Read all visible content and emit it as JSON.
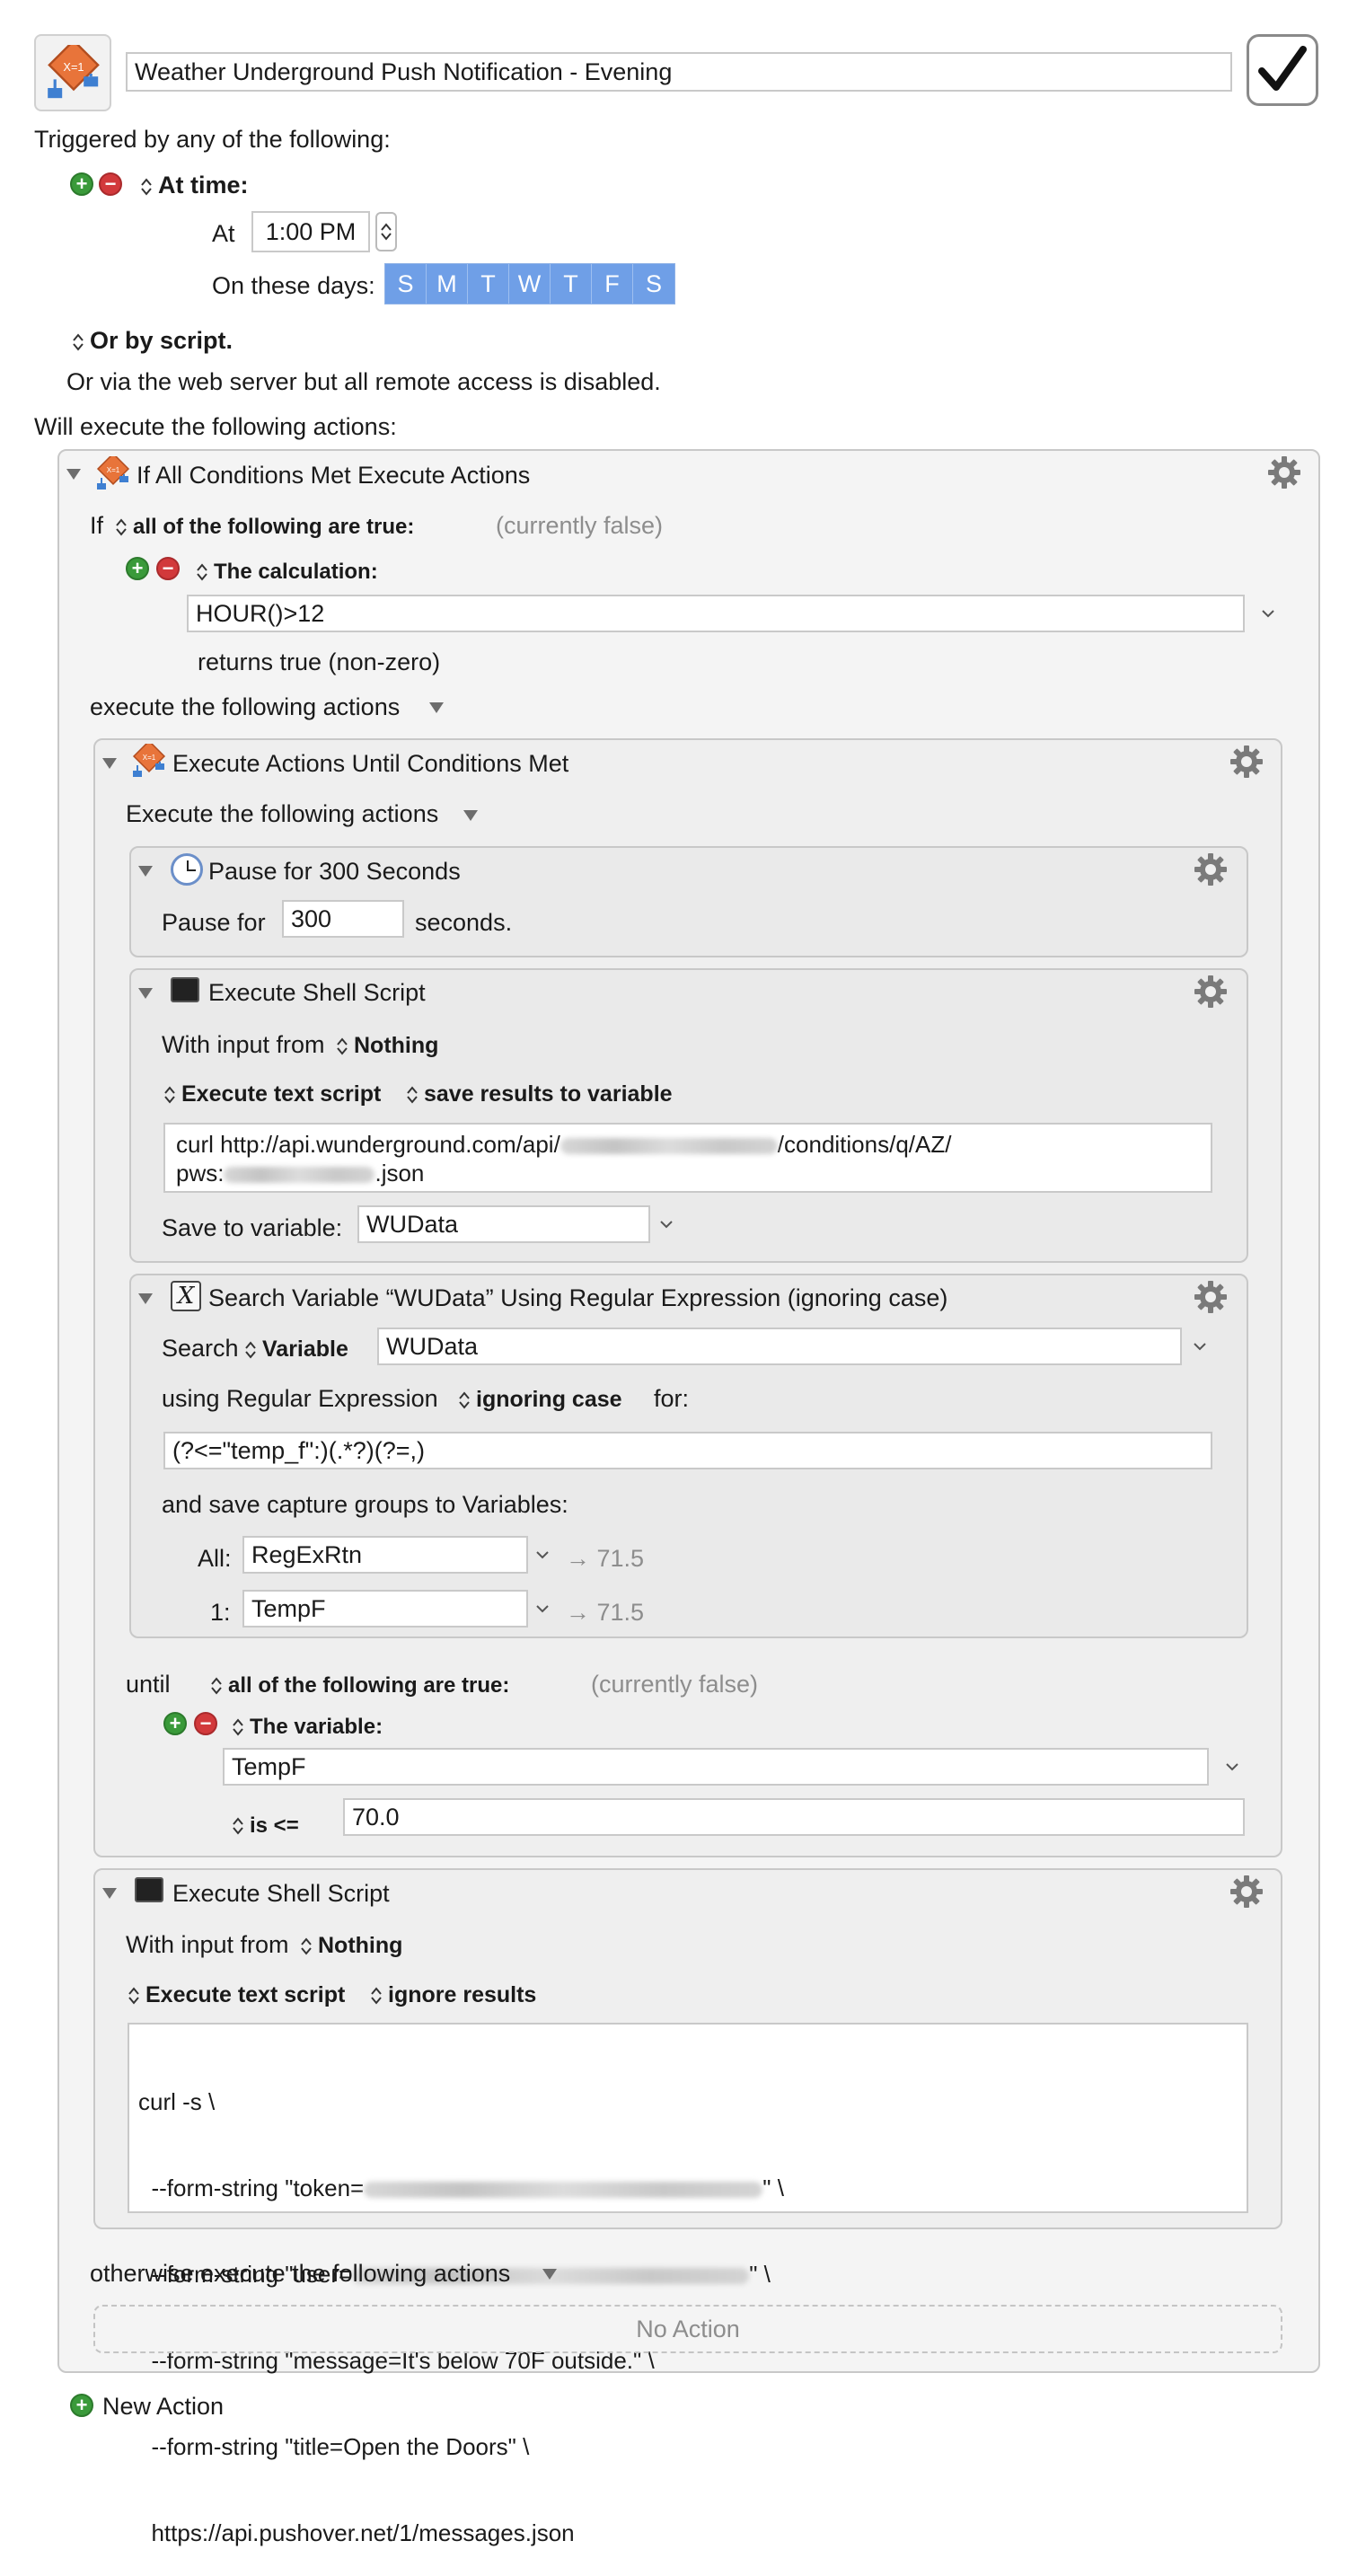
{
  "macro": {
    "name": "Weather Underground Push Notification - Evening",
    "enabled": true
  },
  "triggers": {
    "header": "Triggered by any of the following:",
    "at_time": {
      "title": "At time:",
      "at_label": "At",
      "time_value": "1:00 PM",
      "days_label": "On these days:",
      "days": [
        "S",
        "M",
        "T",
        "W",
        "T",
        "F",
        "S"
      ]
    },
    "or_by_script": "Or by script.",
    "web_server_note": "Or via the web server but all remote access is disabled."
  },
  "actions_header": "Will execute the following actions:",
  "if_action": {
    "title": "If All Conditions Met Execute Actions",
    "if_label": "If",
    "condition_mode": "all of the following are true:",
    "condition_state": "(currently false)",
    "calc_title": "The calculation:",
    "calc_value": "HOUR()>12",
    "calc_note": "returns true (non-zero)",
    "then_label": "execute the following actions",
    "otherwise_label": "otherwise execute the following actions",
    "no_action": "No Action"
  },
  "until_action": {
    "title": "Execute Actions Until Conditions Met",
    "exec_label": "Execute the following actions",
    "pause": {
      "title": "Pause for 300 Seconds",
      "label": "Pause for",
      "value": "300",
      "unit": "seconds."
    },
    "shell1": {
      "title": "Execute Shell Script",
      "input_label": "With input from",
      "input_value": "Nothing",
      "mode": "Execute text script",
      "result_mode": "save results to variable",
      "script_line1_a": "curl http://api.wunderground.com/api/",
      "script_line1_b": "/conditions/q/AZ/",
      "script_line2_a": "pws:",
      "script_line2_b": ".json",
      "save_label": "Save to variable:",
      "save_value": "WUData"
    },
    "regex": {
      "title": "Search Variable “WUData” Using Regular Expression (ignoring case)",
      "search_label": "Search",
      "source_type": "Variable",
      "source_value": "WUData",
      "using_label": "using Regular Expression",
      "case_mode": "ignoring case",
      "for_label": "for:",
      "pattern": "(?<=\"temp_f\":)(.*?)(?=,)",
      "capture_label": "and save capture groups to Variables:",
      "all_label": "All:",
      "all_var": "RegExRtn",
      "all_result": "→ 71.5",
      "g1_label": "1:",
      "g1_var": "TempF",
      "g1_result": "→ 71.5"
    },
    "until_label": "until",
    "until_mode": "all of the following are true:",
    "until_state": "(currently false)",
    "var_cond_title": "The variable:",
    "var_name": "TempF",
    "operator": "is <=",
    "compare_value": "70.0"
  },
  "shell2": {
    "title": "Execute Shell Script",
    "input_label": "With input from",
    "input_value": "Nothing",
    "mode": "Execute text script",
    "result_mode": "ignore results",
    "lines": [
      "curl -s \\",
      "  --form-string \"token=",
      "  --form-string \"user=",
      "  --form-string \"message=It's below 70F outside.\" \\",
      "  --form-string \"title=Open the Doors\" \\",
      "  https://api.pushover.net/1/messages.json"
    ],
    "line_end": "\" \\"
  },
  "new_action": "New Action"
}
